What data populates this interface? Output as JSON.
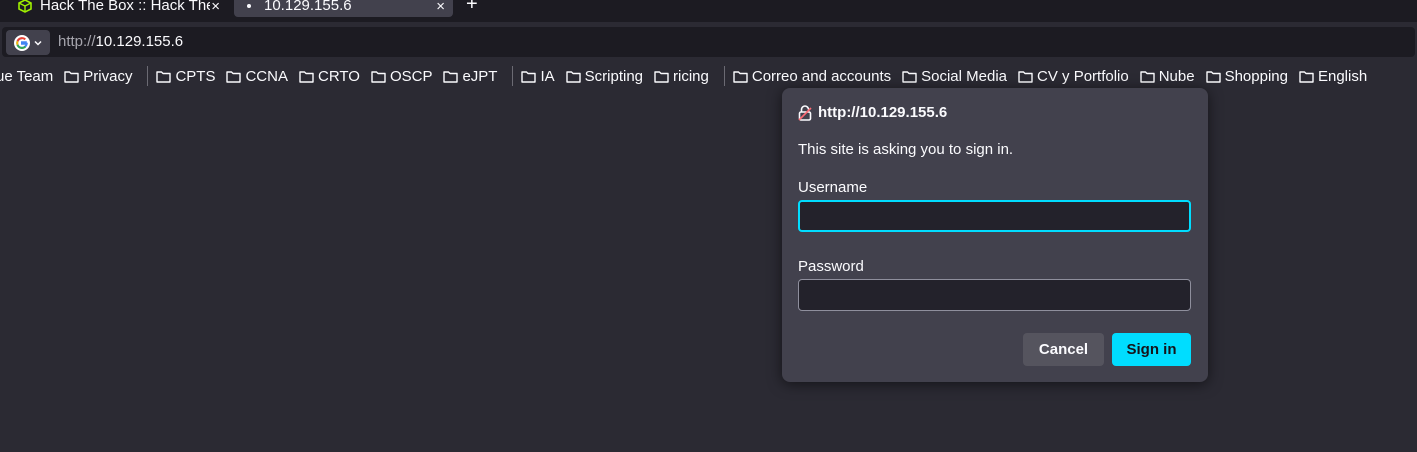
{
  "tabs": [
    {
      "title": "Hack The Box :: Hack The Box",
      "active": false,
      "icon": "htb-cube-icon"
    },
    {
      "title": "10.129.155.6",
      "active": true,
      "icon": "loading-icon"
    }
  ],
  "new_tab_glyph": "+",
  "close_glyph": "×",
  "url": {
    "protocol": "http://",
    "host": "10.129.155.6"
  },
  "search_engine_icon": "google-icon",
  "bookmarks": [
    "ue Team",
    "Privacy",
    "|",
    "CPTS",
    "CCNA",
    "CRTO",
    "OSCP",
    "eJPT",
    "|",
    "IA",
    "Scripting",
    "ricing",
    "|",
    "Correo and accounts",
    "Social Media",
    "CV y Portfolio",
    "Nube",
    "Shopping",
    "English"
  ],
  "dialog": {
    "origin": "http://10.129.155.6",
    "message": "This site is asking you to sign in.",
    "username_label": "Username",
    "username_value": "",
    "password_label": "Password",
    "password_value": "",
    "cancel_label": "Cancel",
    "signin_label": "Sign in"
  },
  "colors": {
    "accent": "#00ddff",
    "background": "#2b2a33",
    "panel": "#42414d"
  }
}
